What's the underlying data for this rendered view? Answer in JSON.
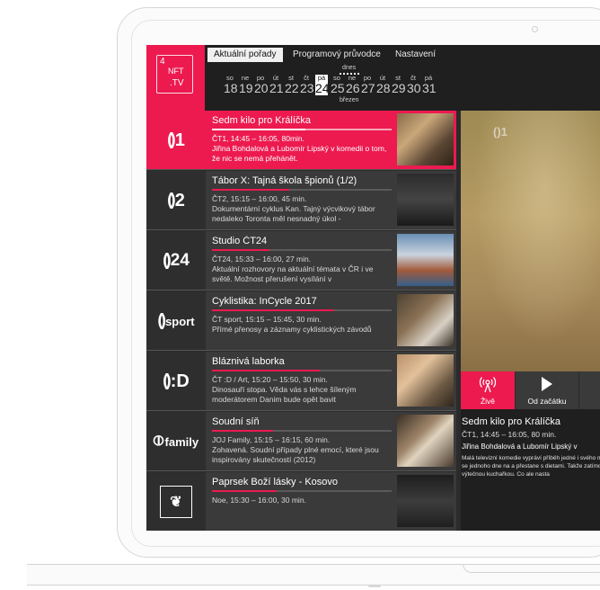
{
  "app": {
    "logo": {
      "num": "4",
      "line1": "NFT",
      "line2": ".TV"
    },
    "tabs": [
      {
        "label": "Aktuální pořady",
        "active": true
      },
      {
        "label": "Programový průvodce",
        "active": false
      },
      {
        "label": "Nastavení",
        "active": false
      }
    ],
    "calendar": {
      "today_label": "dnes",
      "month_label": "březen",
      "days": [
        {
          "name": "so",
          "num": "18"
        },
        {
          "name": "ne",
          "num": "19"
        },
        {
          "name": "po",
          "num": "20"
        },
        {
          "name": "út",
          "num": "21"
        },
        {
          "name": "st",
          "num": "22"
        },
        {
          "name": "čt",
          "num": "23"
        },
        {
          "name": "pá",
          "num": "24",
          "today": true
        },
        {
          "name": "so",
          "num": "25"
        },
        {
          "name": "ne",
          "num": "26"
        },
        {
          "name": "po",
          "num": "27"
        },
        {
          "name": "út",
          "num": "28"
        },
        {
          "name": "st",
          "num": "29"
        },
        {
          "name": "čt",
          "num": "30"
        },
        {
          "name": "pá",
          "num": "31"
        }
      ]
    },
    "channels": [
      {
        "logo": "()1",
        "title": "Sedm kilo pro Králíčka",
        "meta": "ČT1, 14:45 – 16:05, 80min.",
        "desc": "Jiřina Bohdalová a Lubomír Lipský v komedii o tom, že nic se nemá přehánět.",
        "progress": 0.52,
        "active": true
      },
      {
        "logo": "()2",
        "title": "Tábor X: Tajná škola špionů (1/2)",
        "meta": "ČT2, 15:15 – 16:00, 45 min.",
        "desc": "Dokumentární cyklus Kan. Tajný výcvikový tábor nedaleko Toronta měl nesnadný úkol -",
        "progress": 0.43,
        "active": false
      },
      {
        "logo": "()24",
        "title": "Studio ČT24",
        "meta": "ČT24, 15:33 – 16:00, 27 min.",
        "desc": "Aktuální rozhovory na aktuální témata v ČR i ve světě. Možnost přerušení vysílání v",
        "progress": 0.32,
        "active": false
      },
      {
        "logo": "()sport",
        "title": "Cyklistika: InCycle 2017",
        "meta": "ČT sport, 15:15 – 15:45, 30 min.",
        "desc": "Přímé přenosy a záznamy cyklistických závodů",
        "progress": 0.68,
        "active": false
      },
      {
        "logo": "():D",
        "title": "Bláznivá laborka",
        "meta": "ČT :D / Art, 15:20 – 15:50, 30 min.",
        "desc": "Dinosauří stopa. Věda vás s lehce šíleným moderátorem Danim bude opět bavit",
        "progress": 0.6,
        "active": false
      },
      {
        "logo": "family",
        "title": "Soudní síň",
        "meta": "JOJ Family, 15:15 – 16:15, 60 min.",
        "desc": "Zohavená. Soudní případy plné emocí, které jsou inspirovány skutečností (2012)",
        "progress": 0.34,
        "active": false
      },
      {
        "logo": "noe",
        "title": "Paprsek Boží lásky - Kosovo",
        "meta": "Noe, 15:30 – 16:00, 30 min.",
        "desc": "",
        "progress": 0.36,
        "active": false
      }
    ],
    "player": {
      "live_label": "Živě",
      "start_label": "Od začátku"
    },
    "detail": {
      "title": "Sedm kilo pro Králíčka",
      "meta": "ČT1, 14:45 – 16:05, 80 min.",
      "subtitle": "Jiřina Bohdalová a Lubomír Lipský v",
      "desc": "Malá televizní komedie vypráví příběh jedné i svého manžela. A tak se jednoho dne na a přestane s dietami. Takže zatímco žena Majkou, výtečnou kuchařkou. Co ale nasta"
    },
    "colors": {
      "accent": "#ec1a4f",
      "panel": "#3a3a3a",
      "header": "#1f1f1f"
    }
  }
}
